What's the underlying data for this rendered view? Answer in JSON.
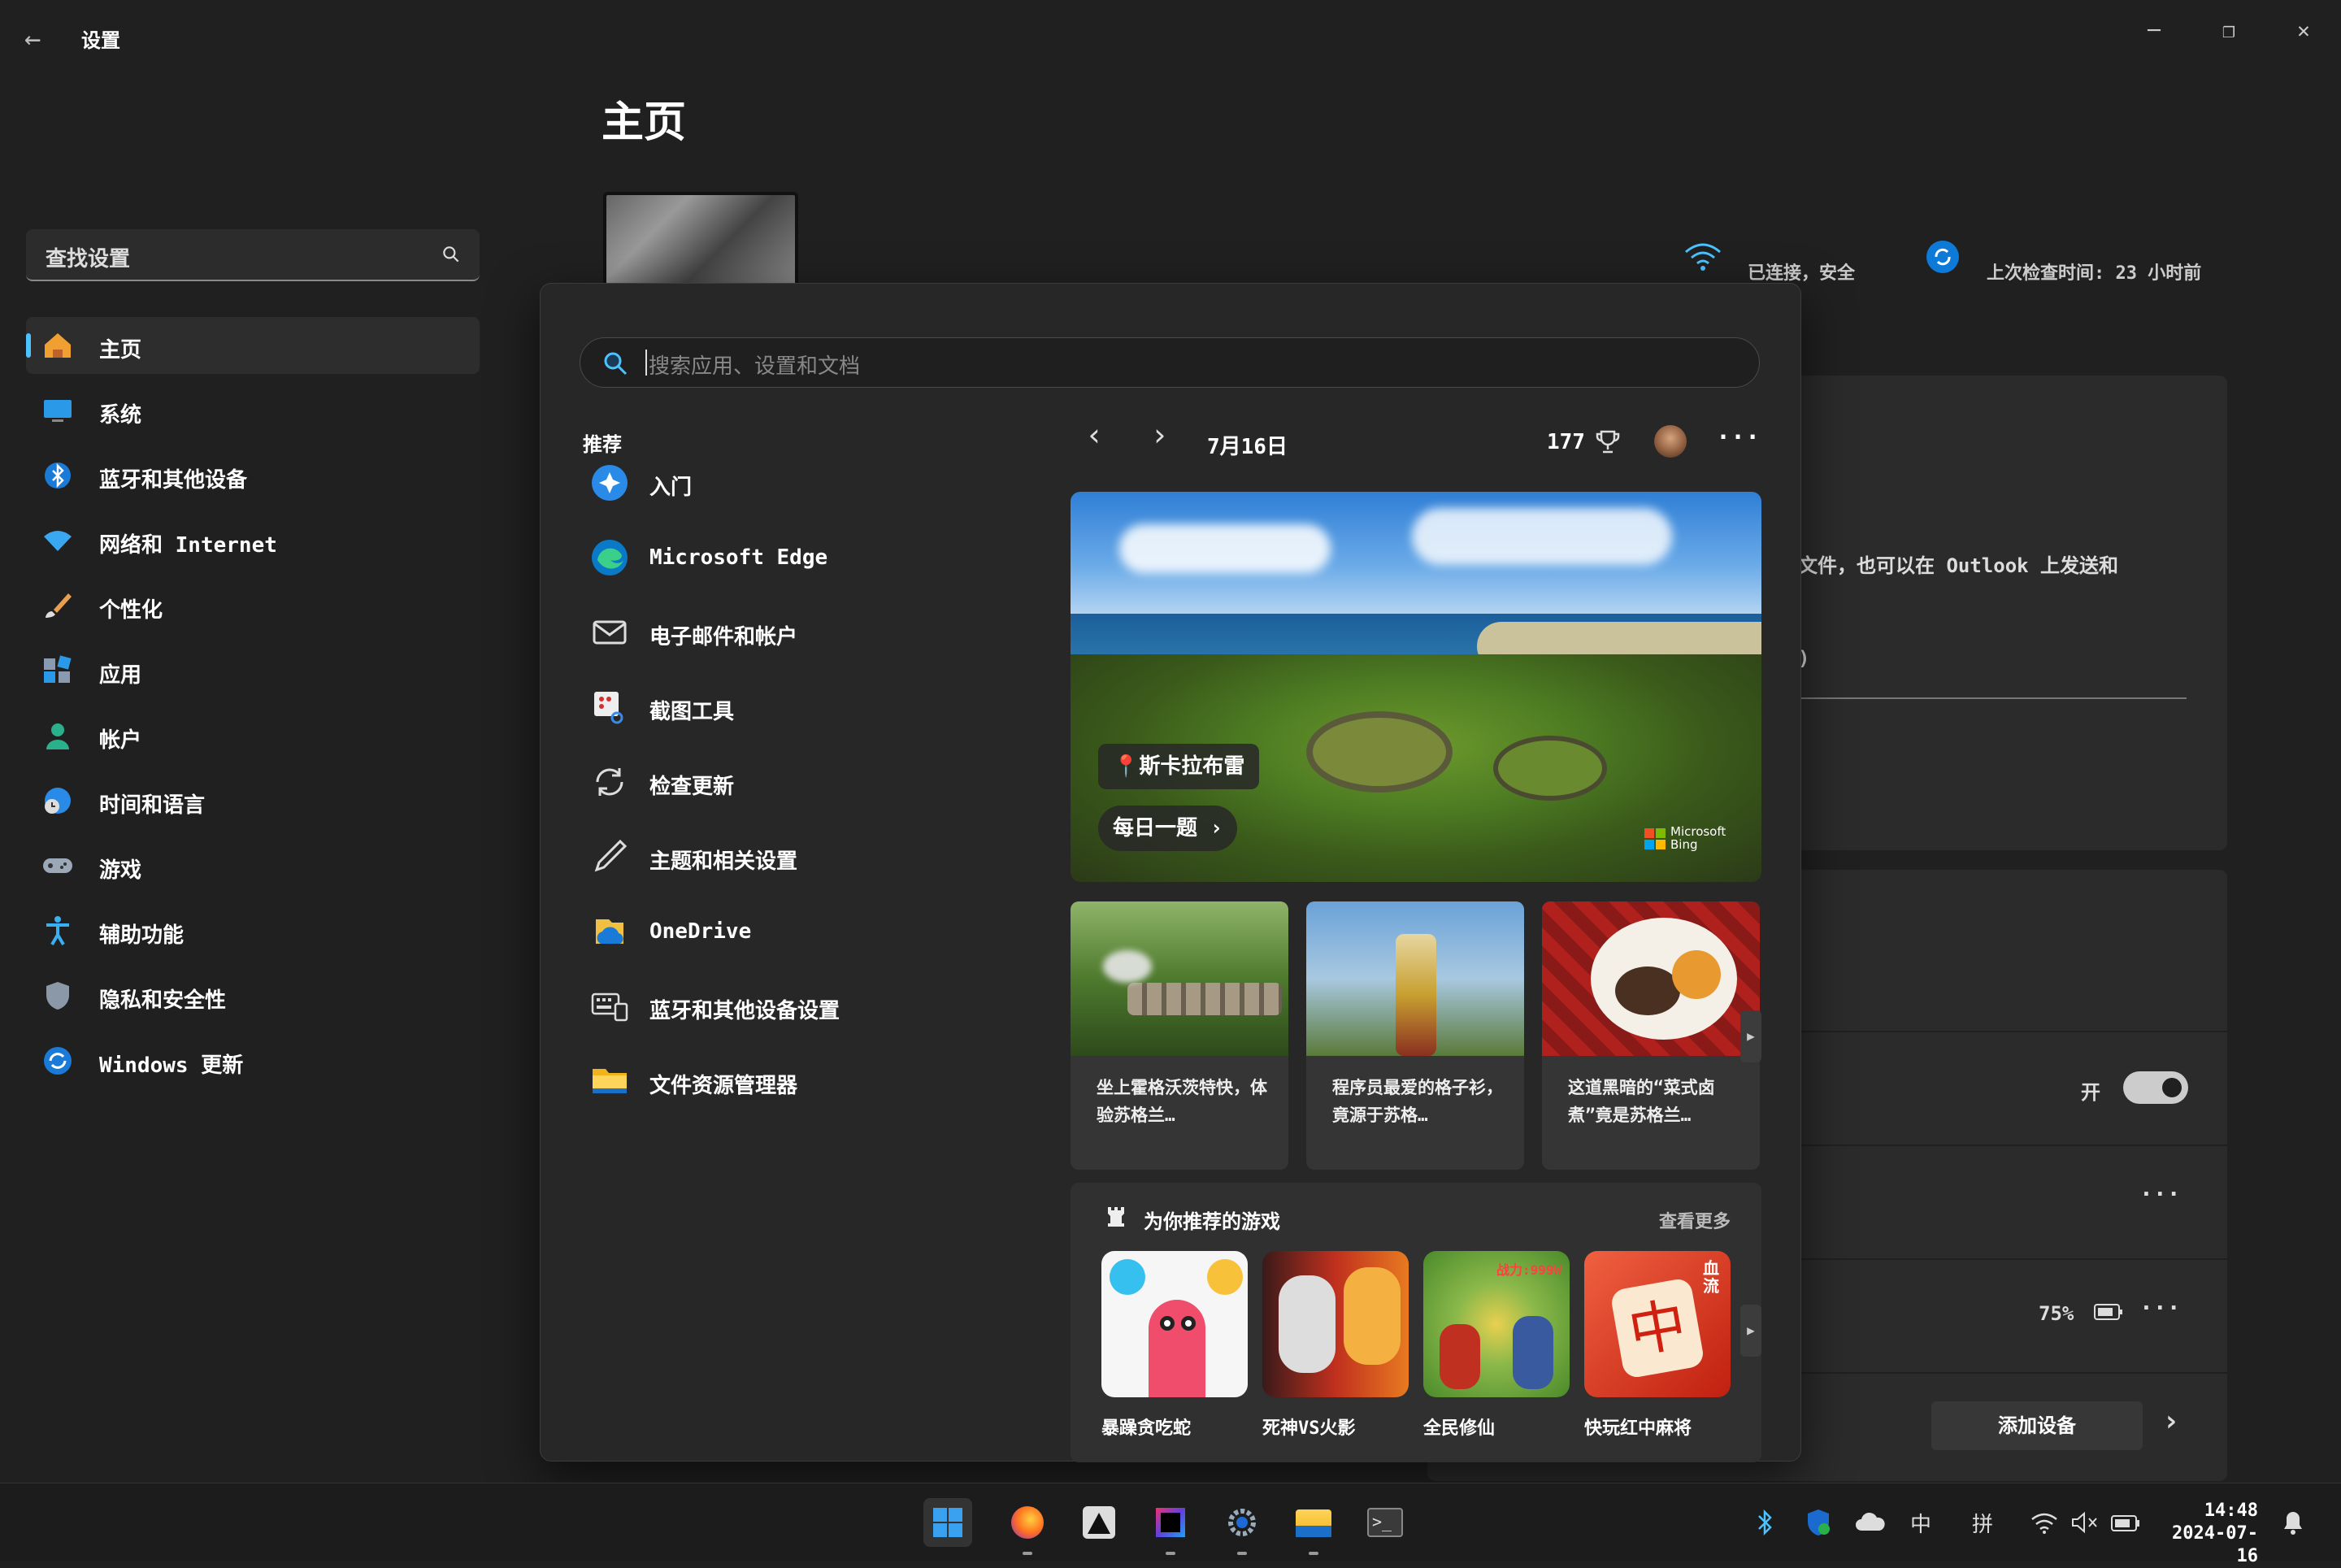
{
  "window": {
    "title": "设置",
    "back_glyph": "←",
    "minimize_glyph": "─",
    "maximize_glyph": "❐",
    "close_glyph": "✕"
  },
  "sidebar": {
    "search_placeholder": "查找设置",
    "items": [
      {
        "label": "主页",
        "icon": "home-icon"
      },
      {
        "label": "系统",
        "icon": "system-icon"
      },
      {
        "label": "蓝牙和其他设备",
        "icon": "bluetooth-icon"
      },
      {
        "label": "网络和 Internet",
        "icon": "wifi-icon"
      },
      {
        "label": "个性化",
        "icon": "brush-icon"
      },
      {
        "label": "应用",
        "icon": "apps-icon"
      },
      {
        "label": "帐户",
        "icon": "account-icon"
      },
      {
        "label": "时间和语言",
        "icon": "clock-globe-icon"
      },
      {
        "label": "游戏",
        "icon": "gamepad-icon"
      },
      {
        "label": "辅助功能",
        "icon": "accessibility-icon"
      },
      {
        "label": "隐私和安全性",
        "icon": "shield-icon"
      },
      {
        "label": "Windows 更新",
        "icon": "update-icon"
      }
    ]
  },
  "main": {
    "page_title": "主页",
    "network_status": "已连接，安全",
    "update_status": "上次检查时间: 23 小时前",
    "card_text_1": "文件，也可以在 Outlook 上发送和",
    "card_text_2": ")",
    "toggle_label": "开",
    "more_glyph": "···",
    "battery_percent": "75%",
    "add_device": "添加设备",
    "chevron_right": "›"
  },
  "start": {
    "search_placeholder": "搜索应用、设置和文档",
    "recommended_title": "推荐",
    "recommended": [
      {
        "label": "入门",
        "icon": "get-started-icon"
      },
      {
        "label": "Microsoft Edge",
        "icon": "edge-icon"
      },
      {
        "label": "电子邮件和帐户",
        "icon": "mail-icon"
      },
      {
        "label": "截图工具",
        "icon": "snipping-tool-icon"
      },
      {
        "label": "检查更新",
        "icon": "sync-icon"
      },
      {
        "label": "主题和相关设置",
        "icon": "pen-icon"
      },
      {
        "label": "OneDrive",
        "icon": "onedrive-icon"
      },
      {
        "label": "蓝牙和其他设备设置",
        "icon": "keyboard-device-icon"
      },
      {
        "label": "文件资源管理器",
        "icon": "folder-icon"
      }
    ],
    "nav_prev": "‹",
    "nav_next": "›",
    "date": "7月16日",
    "points": "177",
    "more": "···",
    "hero": {
      "location": "斯卡拉布雷",
      "quiz": "每日一题 ›",
      "bing_brand": "Microsoft Bing"
    },
    "news": [
      {
        "text": "坐上霍格沃茨特快，体验苏格兰…"
      },
      {
        "text": "程序员最爱的格子衫，竟源于苏格…"
      },
      {
        "text": "这道黑暗的“菜式卤煮”竟是苏格兰…"
      }
    ],
    "games_title": "为你推荐的游戏",
    "games_more": "查看更多",
    "games": [
      {
        "label": "暴躁贪吃蛇"
      },
      {
        "label": "死神VS火影"
      },
      {
        "label": "全民修仙"
      },
      {
        "label": "快玩红中麻将"
      }
    ],
    "game_tile_texts": {
      "power": "战力:999W",
      "mahjong_char": "中",
      "blood": "血流"
    },
    "scroll_glyph": "▶"
  },
  "taskbar": {
    "apps": [
      "start-icon",
      "firefox-icon",
      "inkscape-icon",
      "intellij-icon",
      "settings-gear-icon",
      "file-explorer-icon",
      "terminal-icon"
    ],
    "ime_lang": "中",
    "ime_mode": "拼",
    "time": "14:48",
    "date": "2024-07-16"
  }
}
